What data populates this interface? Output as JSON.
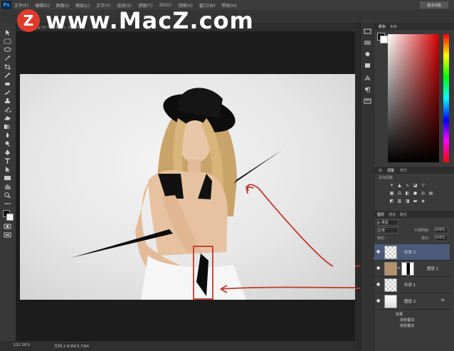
{
  "app": {
    "logo": "Ps"
  },
  "menu": [
    "文件(F)",
    "编辑(E)",
    "图像(I)",
    "图层(L)",
    "文字(Y)",
    "选择(S)",
    "滤镜(T)",
    "3D(D)",
    "视图(V)",
    "窗口(W)",
    "帮助(H)"
  ],
  "workspace": "基本功能",
  "doc_tab": "未标题-1 @ 66.7% (形状 2, RGB/8)",
  "watermark": {
    "logo_letter": "Z",
    "text": "www.MacZ.com"
  },
  "status": {
    "zoom": "102.36%",
    "doc": "文档:2.63M/3.79M"
  },
  "panels": {
    "color_tabs": [
      "颜色",
      "色板"
    ],
    "adjust_tabs": [
      "库",
      "调整",
      "样式"
    ],
    "adjust_title": "添加调整",
    "layers_tabs": [
      "图层",
      "通道",
      "路径"
    ],
    "filter_kind": "p 类型",
    "blend_mode": "正常",
    "opacity_label": "不透明度:",
    "opacity_value": "100%",
    "lock_label": "锁定:",
    "fill_label": "填充:",
    "fill_value": "100%"
  },
  "layers": [
    {
      "name": "形状 2",
      "selected": true
    },
    {
      "name": "图层 1",
      "selected": false
    },
    {
      "name": "形状 1",
      "selected": false
    },
    {
      "name": "图层 2",
      "selected": false
    }
  ],
  "effects": {
    "label": "效果",
    "items": [
      "渐变叠加",
      "渐变叠加"
    ]
  },
  "colors": {
    "accent_red": "#c0392b",
    "selected_layer": "#4a5a78"
  }
}
